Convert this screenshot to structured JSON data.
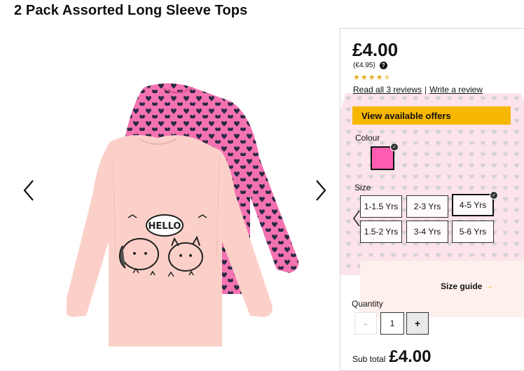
{
  "product": {
    "title": "2 Pack Assorted Long Sleeve Tops",
    "tshirt_text": "HELLO"
  },
  "gallery": {
    "prev_icon": "chevron-left-icon",
    "next_icon": "chevron-right-icon",
    "colors": {
      "pink": "#f472b0",
      "peach": "#fbd0c8",
      "heart": "#1d2540"
    }
  },
  "panel": {
    "price": "£4.00",
    "price_eur": "(€4.95)",
    "help_icon": "?",
    "rating": 4.5,
    "rating_max": 5,
    "reviews_link": "Read all 3 reviews",
    "separator": "|",
    "write_review_link": "Write a review",
    "offers_button": "View available offers",
    "colour_label": "Colour",
    "selected_colour": "#ff5db1",
    "size_label": "Size",
    "sizes": [
      {
        "label": "1-1.5 Yrs",
        "selected": false
      },
      {
        "label": "2-3 Yrs",
        "selected": false
      },
      {
        "label": "4-5 Yrs",
        "selected": true
      },
      {
        "label": "1.5-2 Yrs",
        "selected": false
      },
      {
        "label": "3-4 Yrs",
        "selected": false
      },
      {
        "label": "5-6 Yrs",
        "selected": false
      }
    ],
    "size_guide_label": "Size guide",
    "size_guide_arrow": "→",
    "quantity_label": "Quantity",
    "quantity_minus": "-",
    "quantity_value": "1",
    "quantity_plus": "+",
    "subtotal_label": "Sub total",
    "subtotal_value": "£4.00",
    "accent": "#f7b600"
  }
}
